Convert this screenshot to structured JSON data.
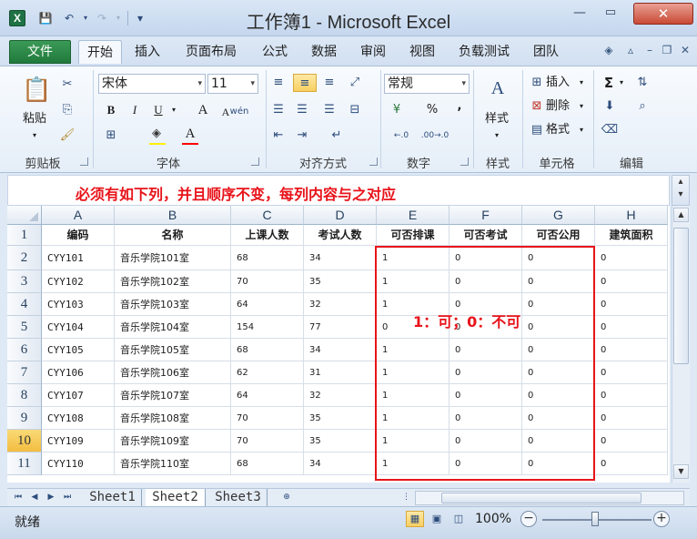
{
  "window": {
    "title": "工作簿1 - Microsoft Excel",
    "min": "—",
    "max": "▭",
    "close": "✕"
  },
  "qat": {
    "app_icon": "X",
    "save": "💾",
    "undo": "↶",
    "redo": "↷",
    "customize": "▾"
  },
  "tabs": [
    {
      "label": "文件"
    },
    {
      "label": "开始"
    },
    {
      "label": "插入"
    },
    {
      "label": "页面布局"
    },
    {
      "label": "公式"
    },
    {
      "label": "数据"
    },
    {
      "label": "审阅"
    },
    {
      "label": "视图"
    },
    {
      "label": "负载测试"
    },
    {
      "label": "团队"
    }
  ],
  "ribbon": {
    "clipboard": {
      "label": "剪贴板",
      "paste": "粘贴"
    },
    "font": {
      "label": "字体",
      "name": "宋体",
      "size": "11",
      "bold": "B",
      "italic": "I",
      "underline": "U",
      "grow": "A",
      "shrink": "A",
      "wen": "wén"
    },
    "alignment": {
      "label": "对齐方式"
    },
    "number": {
      "label": "数字",
      "format": "常规",
      "percent": "%",
      "comma": ",",
      "inc": "←.0",
      "dec": ".00→.0"
    },
    "styles": {
      "label": "样式",
      "btn": "样式"
    },
    "cells": {
      "label": "单元格",
      "insert": "插入",
      "delete": "删除",
      "format": "格式"
    },
    "editing": {
      "label": "编辑",
      "sum": "Σ"
    }
  },
  "annotation": {
    "top": "必须有如下列，并且顺序不变，每列内容与之对应",
    "legend": "1：可；0：不可"
  },
  "columns": [
    "A",
    "B",
    "C",
    "D",
    "E",
    "F",
    "G",
    "H"
  ],
  "rows": [
    "1",
    "2",
    "3",
    "4",
    "5",
    "6",
    "7",
    "8",
    "9",
    "10",
    "11"
  ],
  "selected_row": "10",
  "table": {
    "headers": [
      "编码",
      "名称",
      "上课人数",
      "考试人数",
      "可否排课",
      "可否考试",
      "可否公用",
      "建筑面积"
    ],
    "data": [
      [
        "CYY101",
        "音乐学院101室",
        "68",
        "34",
        "1",
        "0",
        "0",
        "0"
      ],
      [
        "CYY102",
        "音乐学院102室",
        "70",
        "35",
        "1",
        "0",
        "0",
        "0"
      ],
      [
        "CYY103",
        "音乐学院103室",
        "64",
        "32",
        "1",
        "0",
        "0",
        "0"
      ],
      [
        "CYY104",
        "音乐学院104室",
        "154",
        "77",
        "0",
        "0",
        "0",
        "0"
      ],
      [
        "CYY105",
        "音乐学院105室",
        "68",
        "34",
        "1",
        "0",
        "0",
        "0"
      ],
      [
        "CYY106",
        "音乐学院106室",
        "62",
        "31",
        "1",
        "0",
        "0",
        "0"
      ],
      [
        "CYY107",
        "音乐学院107室",
        "64",
        "32",
        "1",
        "0",
        "0",
        "0"
      ],
      [
        "CYY108",
        "音乐学院108室",
        "70",
        "35",
        "1",
        "0",
        "0",
        "0"
      ],
      [
        "CYY109",
        "音乐学院109室",
        "70",
        "35",
        "1",
        "0",
        "0",
        "0"
      ],
      [
        "CYY110",
        "音乐学院110室",
        "68",
        "34",
        "1",
        "0",
        "0",
        "0"
      ]
    ]
  },
  "sheets": [
    "Sheet1",
    "Sheet2",
    "Sheet3"
  ],
  "active_sheet": "Sheet2",
  "status": {
    "ready": "就绪",
    "zoom": "100%"
  }
}
